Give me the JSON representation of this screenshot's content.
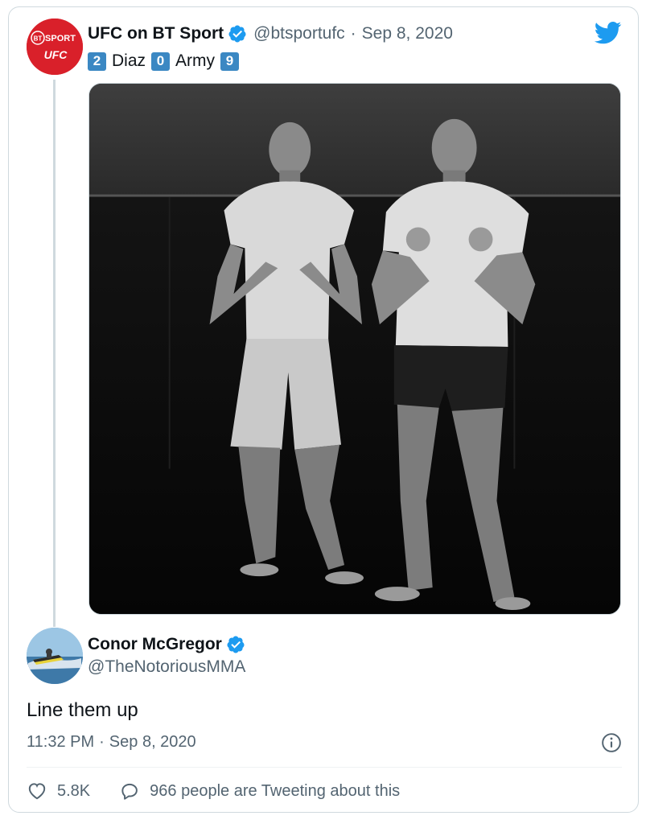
{
  "parent_tweet": {
    "author_name": "UFC on BT Sport",
    "author_handle": "@btsportufc",
    "separator": "·",
    "date": "Sep 8, 2020",
    "avatar": {
      "line1": "BT SPORT",
      "line2": "UFC",
      "color": "#d9202a"
    },
    "text": {
      "kb1": "2",
      "word1": "Diaz",
      "kb2": "0",
      "word2": "Army",
      "kb3": "9"
    },
    "media": {
      "description_icon": "photo-icon"
    }
  },
  "reply_tweet": {
    "author_name": "Conor McGregor",
    "author_handle": "@TheNotoriousMMA",
    "text": "Line them up",
    "time": "11:32 PM",
    "separator": "·",
    "date": "Sep 8, 2020"
  },
  "actions": {
    "like_count": "5.8K",
    "reply_label": "966 people are Tweeting about this"
  },
  "colors": {
    "verified": "#1d9bf0",
    "twitter_blue": "#1d9bf0",
    "muted_text": "#536471",
    "keycap": "#3b88c3"
  }
}
